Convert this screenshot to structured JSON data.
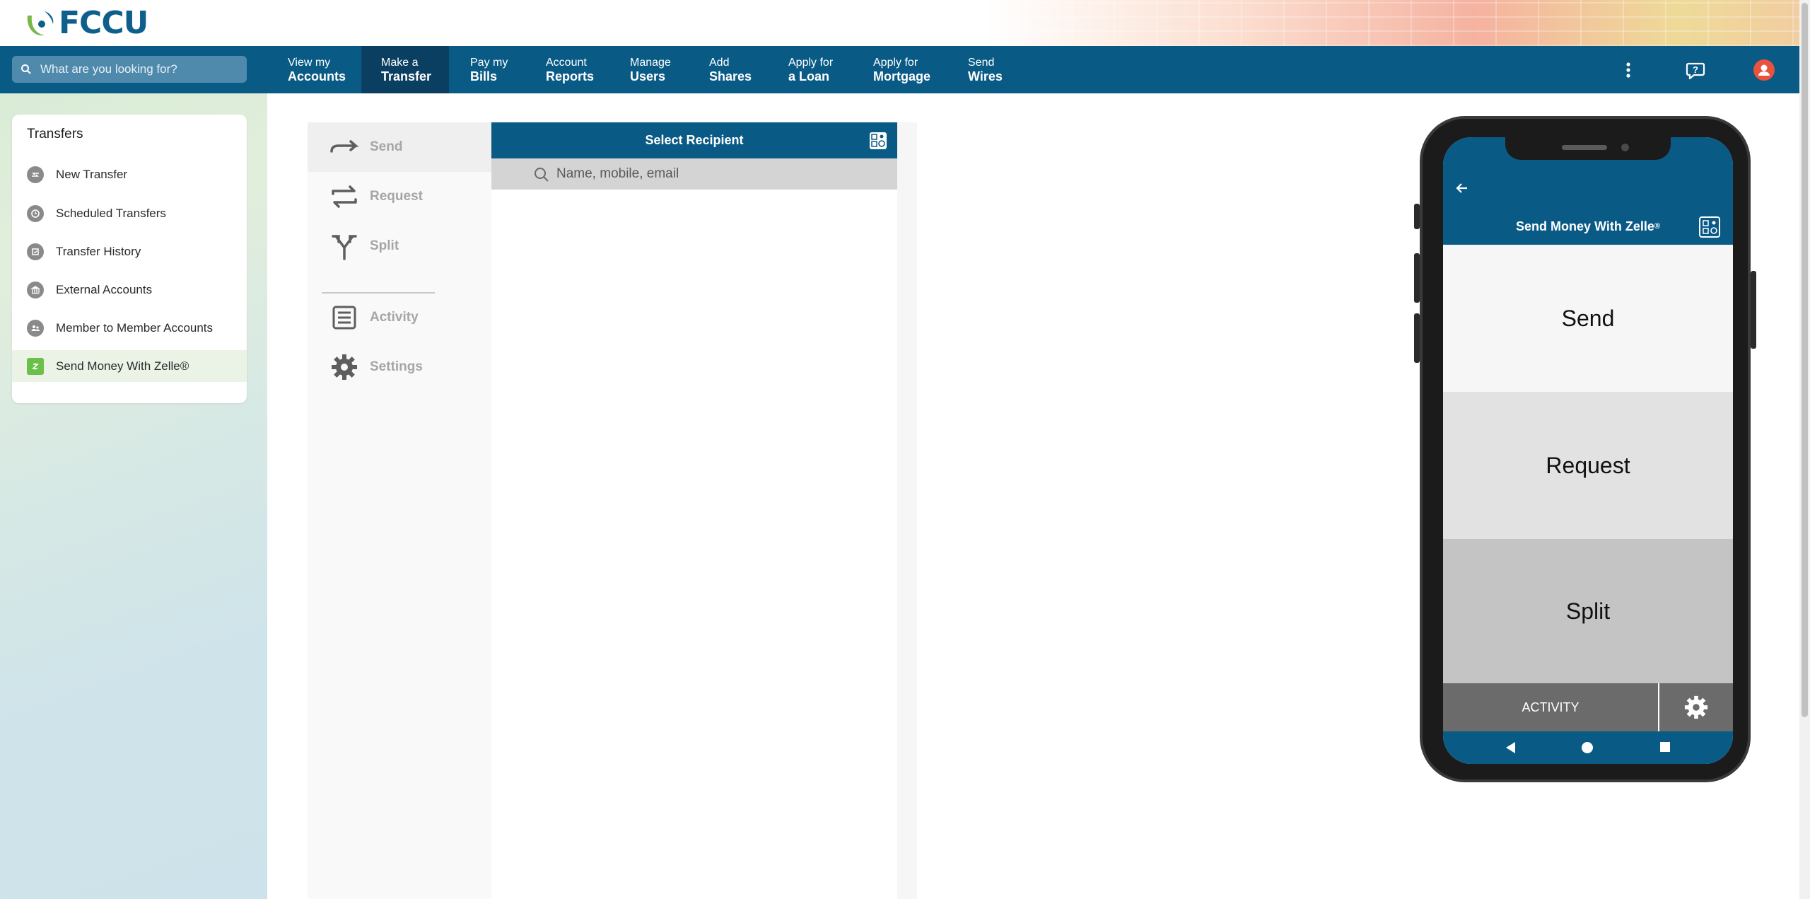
{
  "brand": {
    "name": "FCCU",
    "primary_color": "#0a5a86",
    "dark_color": "#0b3f61",
    "accent_green": "#6cc04a"
  },
  "search": {
    "placeholder": "What are you looking for?"
  },
  "nav": [
    {
      "line1": "View my",
      "line2": "Accounts"
    },
    {
      "line1": "Make a",
      "line2": "Transfer",
      "active": true
    },
    {
      "line1": "Pay my",
      "line2": "Bills"
    },
    {
      "line1": "Account",
      "line2": "Reports"
    },
    {
      "line1": "Manage",
      "line2": "Users"
    },
    {
      "line1": "Add",
      "line2": "Shares"
    },
    {
      "line1": "Apply for",
      "line2": "a Loan"
    },
    {
      "line1": "Apply for",
      "line2": "Mortgage"
    },
    {
      "line1": "Send",
      "line2": "Wires"
    }
  ],
  "nav_icons": [
    "more-vertical-icon",
    "help-chat-icon",
    "user-avatar-icon"
  ],
  "sidebar": {
    "title": "Transfers",
    "items": [
      {
        "label": "New Transfer",
        "icon": "transfer-arrows-icon"
      },
      {
        "label": "Scheduled Transfers",
        "icon": "clock-icon"
      },
      {
        "label": "Transfer History",
        "icon": "history-icon"
      },
      {
        "label": "External Accounts",
        "icon": "bank-icon"
      },
      {
        "label": "Member to Member Accounts",
        "icon": "members-icon"
      },
      {
        "label": "Send Money With Zelle®",
        "icon": "zelle-icon",
        "selected": true
      }
    ]
  },
  "zelle_panel": {
    "menu": [
      {
        "label": "Send",
        "icon": "send-arrow-icon"
      },
      {
        "label": "Request",
        "icon": "request-arrows-icon"
      },
      {
        "label": "Split",
        "icon": "split-icon"
      },
      {
        "label": "Activity",
        "icon": "activity-list-icon"
      },
      {
        "label": "Settings",
        "icon": "settings-gear-icon"
      }
    ],
    "header_title": "Select Recipient",
    "search_placeholder": "Name, mobile, email"
  },
  "phone": {
    "title": "Send Money With Zelle",
    "title_mark": "®",
    "options": [
      "Send",
      "Request",
      "Split"
    ],
    "activity_label": "ACTIVITY"
  }
}
